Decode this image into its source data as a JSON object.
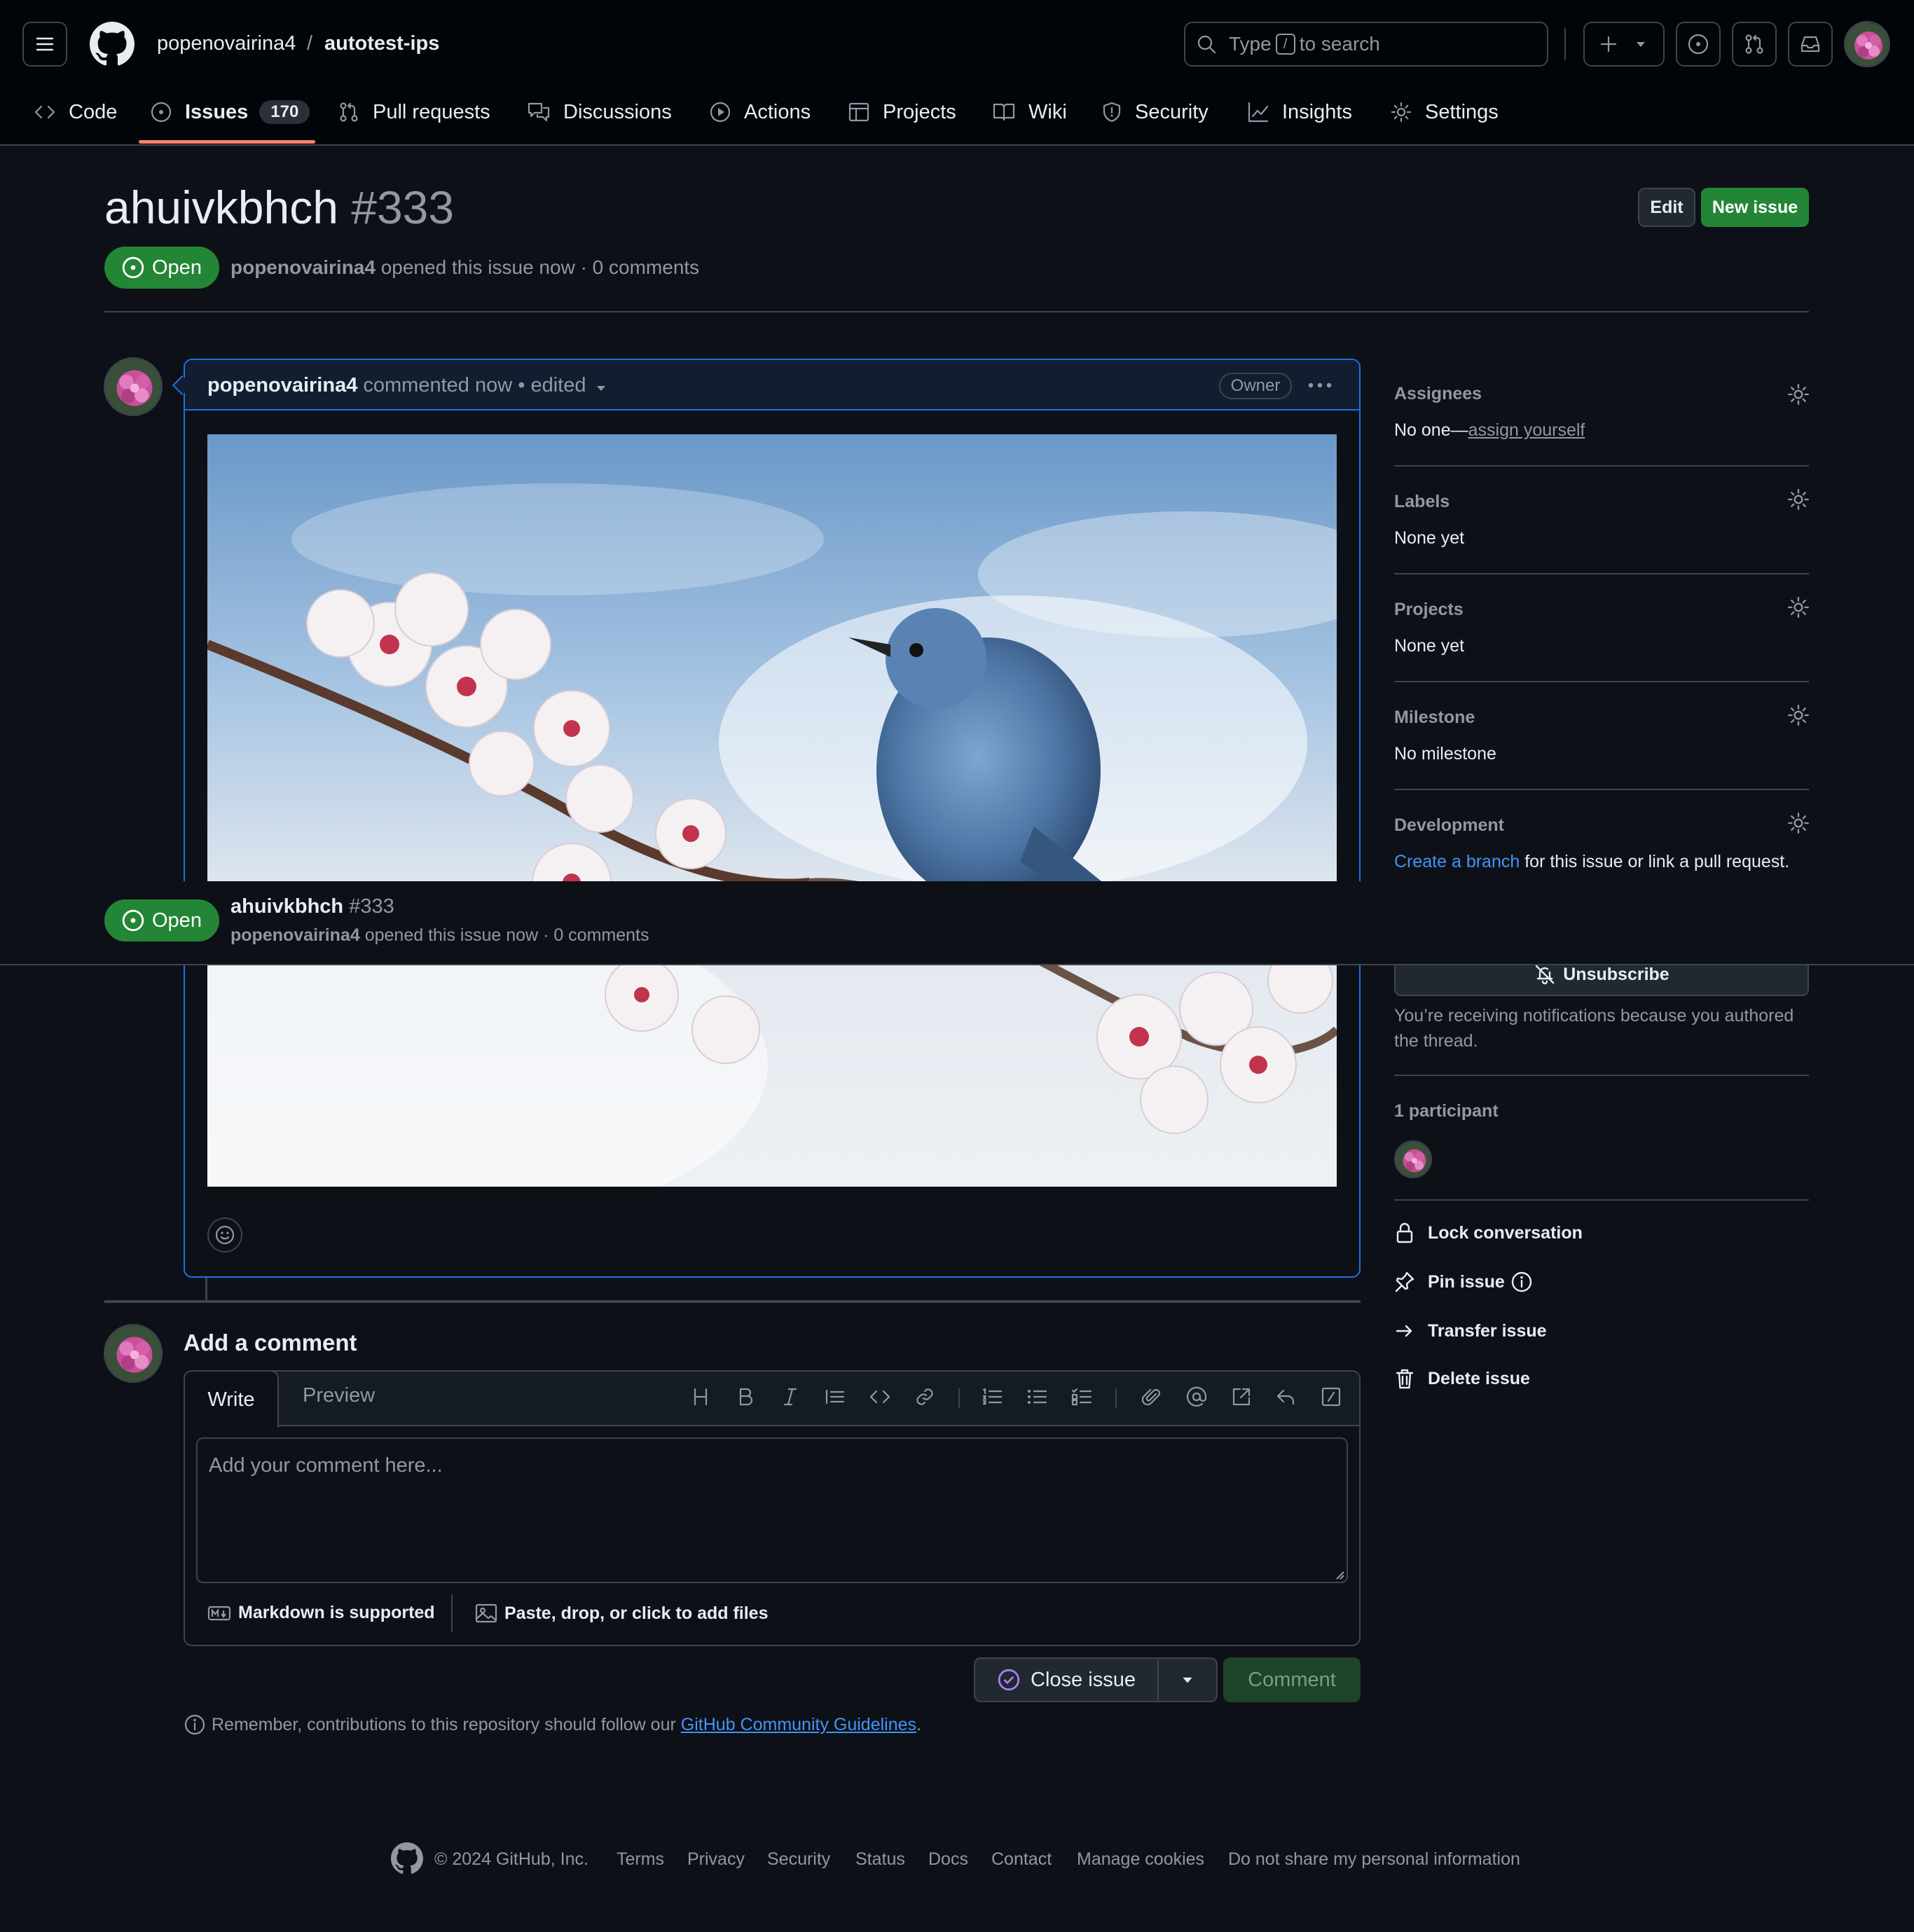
{
  "header": {
    "owner": "popenovairina4",
    "separator": "/",
    "repo": "autotest-ips",
    "search": {
      "prefix": "Type",
      "key": "/",
      "suffix": "to search"
    }
  },
  "tabs": [
    {
      "label": "Code",
      "icon": "code-icon"
    },
    {
      "label": "Issues",
      "icon": "issue-opened-icon",
      "count": "170",
      "selected": true
    },
    {
      "label": "Pull requests",
      "icon": "git-pull-request-icon"
    },
    {
      "label": "Discussions",
      "icon": "comment-discussion-icon"
    },
    {
      "label": "Actions",
      "icon": "play-icon"
    },
    {
      "label": "Projects",
      "icon": "table-icon"
    },
    {
      "label": "Wiki",
      "icon": "book-icon"
    },
    {
      "label": "Security",
      "icon": "shield-icon"
    },
    {
      "label": "Insights",
      "icon": "graph-icon"
    },
    {
      "label": "Settings",
      "icon": "gear-icon"
    }
  ],
  "issue": {
    "title": "ahuivkbhch",
    "number": "#333",
    "state": "Open",
    "author": "popenovairina4",
    "opened_text": "opened this issue now · 0 comments",
    "edit_label": "Edit",
    "new_issue_label": "New issue"
  },
  "comment": {
    "author": "popenovairina4",
    "time": "commented now",
    "edited": "• edited",
    "role": "Owner",
    "image_alt": "blue bird on blossoming branch"
  },
  "sticky": {
    "title": "ahuivkbhch",
    "number": "#333",
    "state": "Open",
    "author": "popenovairina4",
    "opened_text": "opened this issue now · 0 comments"
  },
  "sidebar": {
    "assignees": {
      "heading": "Assignees",
      "value": "No one—",
      "link": "assign yourself"
    },
    "labels": {
      "heading": "Labels",
      "value": "None yet"
    },
    "projects": {
      "heading": "Projects",
      "value": "None yet"
    },
    "milestone": {
      "heading": "Milestone",
      "value": "No milestone"
    },
    "development": {
      "heading": "Development",
      "link": "Create a branch",
      "value": "for this issue or link a pull request."
    },
    "notifications": {
      "button": "Unsubscribe",
      "note_line1": "You’re receiving notifications because you authored",
      "note_line2": "the thread."
    },
    "participants": {
      "heading": "1 participant"
    },
    "actions": {
      "lock": "Lock conversation",
      "pin": "Pin issue",
      "transfer": "Transfer issue",
      "delete": "Delete issue"
    }
  },
  "add_comment": {
    "heading": "Add a comment",
    "write_tab": "Write",
    "preview_tab": "Preview",
    "placeholder": "Add your comment here...",
    "markdown_note": "Markdown is supported",
    "files_note": "Paste, drop, or click to add files",
    "close_label": "Close issue",
    "comment_label": "Comment",
    "guidelines_prefix": "Remember, contributions to this repository should follow our",
    "guidelines_link": "GitHub Community Guidelines",
    "guidelines_suffix": "."
  },
  "footer": {
    "copyright": "© 2024 GitHub, Inc.",
    "links": [
      "Terms",
      "Privacy",
      "Security",
      "Status",
      "Docs",
      "Contact",
      "Manage cookies",
      "Do not share my personal information"
    ]
  },
  "colors": {
    "background": "#0d1117",
    "header": "#010409",
    "accent_green": "#238636",
    "link_blue": "#4493f8",
    "border": "#3d444d",
    "active_tab_underline": "#f78166"
  }
}
